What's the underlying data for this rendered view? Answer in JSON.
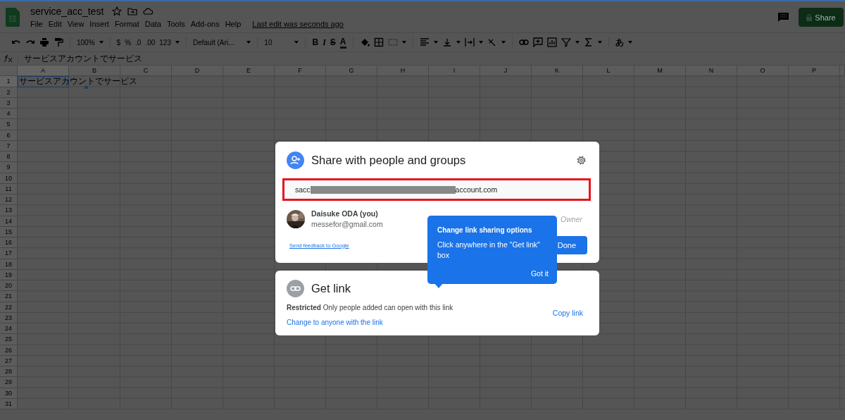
{
  "document": {
    "title": "service_acc_test",
    "menu": [
      "File",
      "Edit",
      "View",
      "Insert",
      "Format",
      "Data",
      "Tools",
      "Add-ons",
      "Help"
    ],
    "last_edit": "Last edit was seconds ago",
    "share_button": "Share"
  },
  "toolbar": {
    "zoom": "100%",
    "currency": "$",
    "percent": "%",
    "decimal_decrease": ".0",
    "decimal_increase": ".00",
    "number_format": "123",
    "font": "Default (Ari...",
    "font_size": "10",
    "bold": "B",
    "italic": "I",
    "strikethrough": "S",
    "text_color": "A",
    "input_tools": "あ"
  },
  "formula_bar": {
    "content": "サービスアカウントでサービス"
  },
  "sheet": {
    "columns": [
      "A",
      "B",
      "C",
      "D",
      "E",
      "F",
      "G",
      "H",
      "I",
      "J",
      "K",
      "L",
      "M",
      "N",
      "O",
      "P"
    ],
    "rows": [
      {
        "number": "1",
        "cells": [
          {
            "text": "サービスアカウントでサービス",
            "selected": true
          }
        ]
      },
      {
        "number": "2"
      },
      {
        "number": "3"
      },
      {
        "number": "4"
      },
      {
        "number": "5"
      },
      {
        "number": "6"
      },
      {
        "number": "7"
      },
      {
        "number": "8"
      },
      {
        "number": "9"
      },
      {
        "number": "10"
      },
      {
        "number": "11"
      },
      {
        "number": "12"
      },
      {
        "number": "13"
      },
      {
        "number": "14"
      },
      {
        "number": "15"
      },
      {
        "number": "16"
      },
      {
        "number": "17"
      },
      {
        "number": "18"
      },
      {
        "number": "19"
      },
      {
        "number": "20"
      },
      {
        "number": "21"
      },
      {
        "number": "22"
      },
      {
        "number": "23"
      },
      {
        "number": "24"
      },
      {
        "number": "25"
      },
      {
        "number": "26"
      },
      {
        "number": "27"
      },
      {
        "number": "28"
      },
      {
        "number": "29"
      },
      {
        "number": "30"
      },
      {
        "number": "31"
      }
    ]
  },
  "share_dialog": {
    "title": "Share with people and groups",
    "field": {
      "value_start": "sacc",
      "value_end": "account.com"
    },
    "people": [
      {
        "name": "Daisuke ODA (you)",
        "email": "messefor@gmail.com",
        "role": "Owner"
      }
    ],
    "feedback_link": "Send feedback to Google",
    "done_button": "Done"
  },
  "get_link": {
    "title": "Get link",
    "description": "**Restricted** Only people added can open with this link",
    "change_link": "Change to anyone with the link",
    "copy_link": "Copy link"
  },
  "tooltip": {
    "title": "Change link sharing options",
    "body": "Click anywhere in the \"Get link\" box",
    "button": "Got it"
  }
}
